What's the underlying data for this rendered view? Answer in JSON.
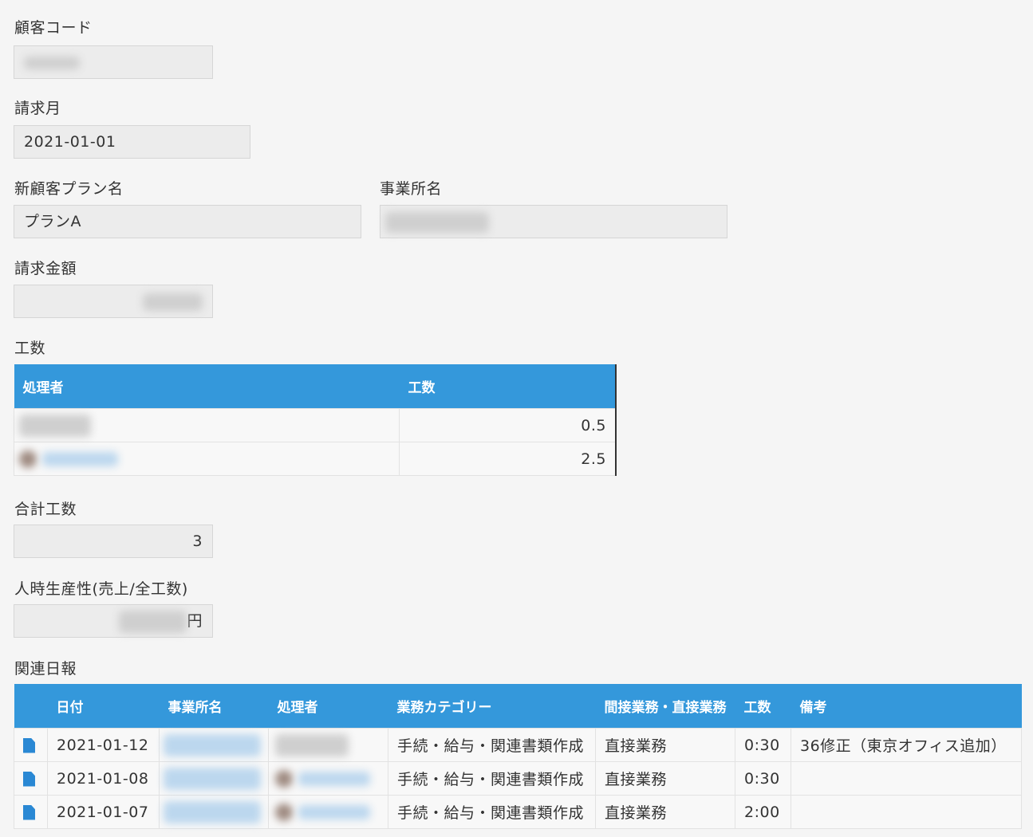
{
  "customer_code": {
    "label": "顧客コード"
  },
  "billing_month": {
    "label": "請求月",
    "value": "2021-01-01"
  },
  "plan_name": {
    "label": "新顧客プラン名",
    "value": "プランA"
  },
  "office_name": {
    "label": "事業所名"
  },
  "billing_amount": {
    "label": "請求金額"
  },
  "work_hours": {
    "label": "工数",
    "columns": [
      "処理者",
      "工数"
    ],
    "rows": [
      {
        "hours": "0.5"
      },
      {
        "hours": "2.5"
      }
    ]
  },
  "total_hours": {
    "label": "合計工数",
    "value": "3"
  },
  "productivity": {
    "label": "人時生産性(売上/全工数)",
    "unit": "円"
  },
  "related_reports": {
    "label": "関連日報",
    "columns": [
      "日付",
      "事業所名",
      "処理者",
      "業務カテゴリー",
      "間接業務・直接業務",
      "工数",
      "備考"
    ],
    "rows": [
      {
        "date": "2021-01-12",
        "category": "手続・給与・関連書類作成",
        "type": "直接業務",
        "hours": "0:30",
        "note": "36修正（東京オフィス追加）"
      },
      {
        "date": "2021-01-08",
        "category": "手続・給与・関連書類作成",
        "type": "直接業務",
        "hours": "0:30",
        "note": ""
      },
      {
        "date": "2021-01-07",
        "category": "手続・給与・関連書類作成",
        "type": "直接業務",
        "hours": "2:00",
        "note": ""
      }
    ]
  },
  "icons": {
    "row_icon": "document-icon"
  },
  "colors": {
    "header": "#3498db",
    "icon": "#2a88d4"
  }
}
